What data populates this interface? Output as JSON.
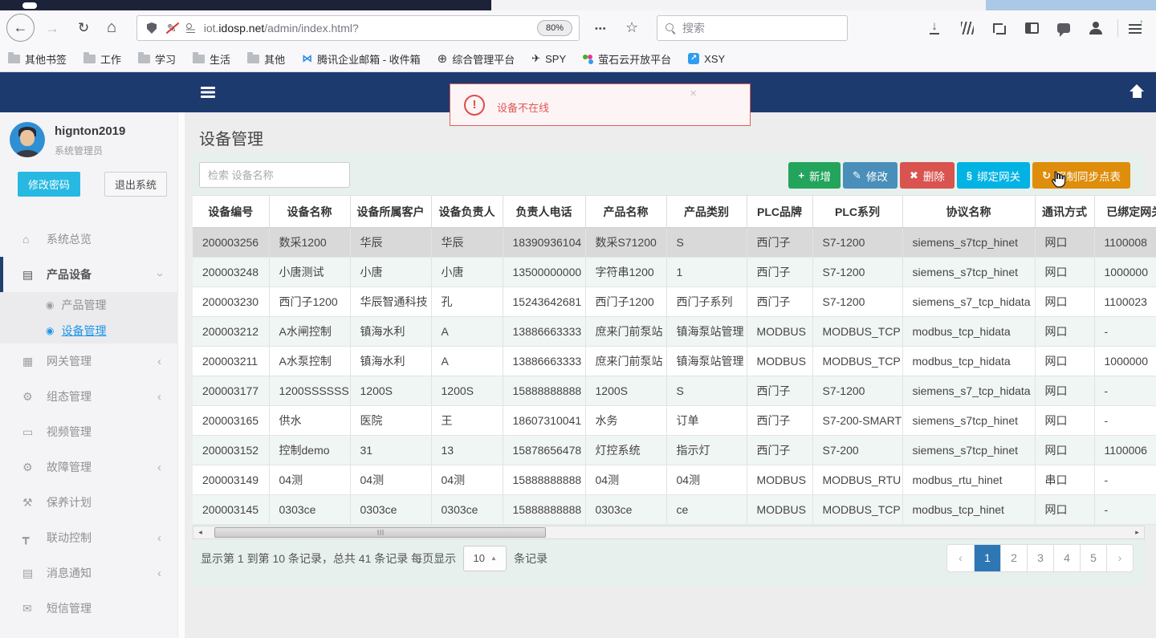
{
  "browser": {
    "toolbar": {
      "url_prefix": "iot.",
      "url_domain": "idosp.net",
      "url_path": "/admin/index.html?",
      "zoom_badge": "80%",
      "search_placeholder": "搜索"
    },
    "bookmarks": [
      {
        "label": "其他书签",
        "icon": "folder-icon"
      },
      {
        "label": "工作",
        "icon": "folder-icon"
      },
      {
        "label": "学习",
        "icon": "folder-icon"
      },
      {
        "label": "生活",
        "icon": "folder-icon"
      },
      {
        "label": "其他",
        "icon": "folder-icon"
      },
      {
        "label": "腾讯企业邮箱 - 收件箱",
        "icon": "tencent-mail-icon"
      },
      {
        "label": "综合管理平台",
        "icon": "globe-icon"
      },
      {
        "label": "SPY",
        "icon": "plane-icon"
      },
      {
        "label": "萤石云开放平台",
        "icon": "ezviz-icon"
      },
      {
        "label": "XSY",
        "icon": "xsy-icon"
      }
    ]
  },
  "app": {
    "alert": {
      "message": "设备不在线"
    },
    "user": {
      "name": "hignton2019",
      "role": "系统管理员",
      "change_password_label": "修改密码",
      "logout_label": "退出系统"
    },
    "sidebar": {
      "items": [
        {
          "label": "系统总览",
          "icon": "home-icon"
        },
        {
          "label": "产品设备",
          "icon": "book-icon",
          "chevron": "down",
          "active": true,
          "children": [
            {
              "label": "产品管理",
              "active": false
            },
            {
              "label": "设备管理",
              "active": true
            }
          ]
        },
        {
          "label": "网关管理",
          "icon": "gateway-icon",
          "chevron": "left"
        },
        {
          "label": "组态管理",
          "icon": "gears-icon",
          "chevron": "left"
        },
        {
          "label": "视频管理",
          "icon": "monitor-icon"
        },
        {
          "label": "故障管理",
          "icon": "gears-icon",
          "chevron": "left"
        },
        {
          "label": "保养计划",
          "icon": "wrench-icon"
        },
        {
          "label": "联动控制",
          "icon": "sitemap-icon",
          "chevron": "left"
        },
        {
          "label": "消息通知",
          "icon": "book-icon",
          "chevron": "left"
        },
        {
          "label": "短信管理",
          "icon": "envelope-icon"
        }
      ]
    },
    "page_title": "设备管理",
    "toolbar": {
      "search_placeholder": "检索 设备名称",
      "buttons": [
        {
          "label": "新增",
          "icon": "plus-icon",
          "color": "#23a45c"
        },
        {
          "label": "修改",
          "icon": "pencil-icon",
          "color": "#4a8fba"
        },
        {
          "label": "删除",
          "icon": "times-icon",
          "color": "#d9534f"
        },
        {
          "label": "绑定网关",
          "icon": "link-icon",
          "color": "#00b3e3"
        },
        {
          "label": "强制同步点表",
          "icon": "sync-icon",
          "color": "#de8e0b"
        }
      ]
    },
    "table": {
      "headers": [
        "设备编号",
        "设备名称",
        "设备所属客户",
        "设备负责人",
        "负责人电话",
        "产品名称",
        "产品类别",
        "PLC品牌",
        "PLC系列",
        "协议名称",
        "通讯方式",
        "已绑定网关"
      ],
      "selected_row_index": 0,
      "rows": [
        [
          "200003256",
          "数采1200",
          "华辰",
          "华辰",
          "18390936104",
          "数采S71200",
          "S",
          "西门子",
          "S7-1200",
          "siemens_s7tcp_hinet",
          "网口",
          "1100008"
        ],
        [
          "200003248",
          "小唐测试",
          "小唐",
          "小唐",
          "13500000000",
          "字符串1200",
          "1",
          "西门子",
          "S7-1200",
          "siemens_s7tcp_hinet",
          "网口",
          "1000000"
        ],
        [
          "200003230",
          "西门子1200",
          "华辰智通科技",
          "孔",
          "15243642681",
          "西门子1200",
          "西门子系列",
          "西门子",
          "S7-1200",
          "siemens_s7_tcp_hidata",
          "网口",
          "1100023"
        ],
        [
          "200003212",
          "A水闸控制",
          "镇海水利",
          "A",
          "13886663333",
          "庶来门前泵站",
          "镇海泵站管理",
          "MODBUS",
          "MODBUS_TCP",
          "modbus_tcp_hidata",
          "网口",
          "-"
        ],
        [
          "200003211",
          "A水泵控制",
          "镇海水利",
          "A",
          "13886663333",
          "庶来门前泵站",
          "镇海泵站管理",
          "MODBUS",
          "MODBUS_TCP",
          "modbus_tcp_hidata",
          "网口",
          "1000000"
        ],
        [
          "200003177",
          "1200SSSSSS",
          "1200S",
          "1200S",
          "15888888888",
          "1200S",
          "S",
          "西门子",
          "S7-1200",
          "siemens_s7_tcp_hidata",
          "网口",
          "-"
        ],
        [
          "200003165",
          "供水",
          "医院",
          "王",
          "18607310041",
          "水务",
          "订单",
          "西门子",
          "S7-200-SMART",
          "siemens_s7tcp_hinet",
          "网口",
          "-"
        ],
        [
          "200003152",
          "控制demo",
          "31",
          "13",
          "15878656478",
          "灯控系统",
          "指示灯",
          "西门子",
          "S7-200",
          "siemens_s7tcp_hinet",
          "网口",
          "1100006"
        ],
        [
          "200003149",
          "04测",
          "04测",
          "04测",
          "15888888888",
          "04测",
          "04测",
          "MODBUS",
          "MODBUS_RTU",
          "modbus_rtu_hinet",
          "串口",
          "-"
        ],
        [
          "200003145",
          "0303ce",
          "0303ce",
          "0303ce",
          "15888888888",
          "0303ce",
          "ce",
          "MODBUS",
          "MODBUS_TCP",
          "modbus_tcp_hinet",
          "网口",
          "-"
        ]
      ]
    },
    "pagination": {
      "summary_prefix": "显示第 1 到第 10 条记录，总共 41 条记录 每页显示",
      "page_size": "10",
      "summary_suffix": "条记录",
      "prev_label": "‹",
      "next_label": "›",
      "pages": [
        "1",
        "2",
        "3",
        "4",
        "5"
      ],
      "active_page": "1"
    },
    "colors": {
      "navbar": "#1d3a6e",
      "active_link": "#1e96e8",
      "pagination_active": "#2d77b5",
      "alert_border": "#e05c5c",
      "change_password": "#27b9e2"
    }
  }
}
